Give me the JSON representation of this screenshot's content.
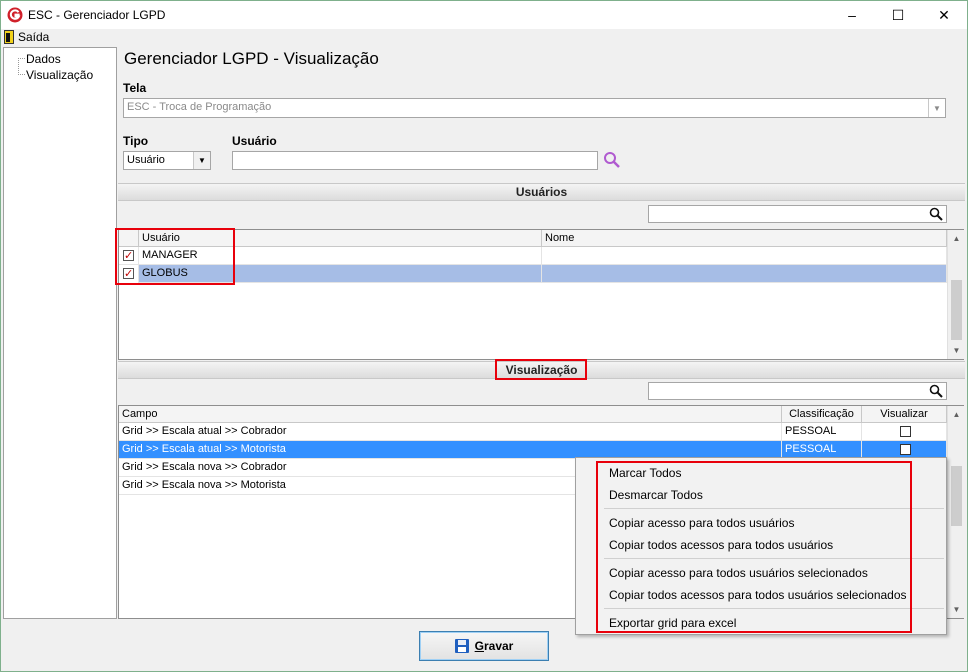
{
  "window": {
    "title": "ESC - Gerenciador LGPD",
    "minimize": "–",
    "maximize": "☐",
    "close": "✕"
  },
  "menu": {
    "saida": "Saída"
  },
  "tree": {
    "items": [
      "Dados",
      "Visualização"
    ]
  },
  "main": {
    "title": "Gerenciador LGPD - Visualização",
    "tela_label": "Tela",
    "tela_value": "ESC - Troca de Programação",
    "tipo_label": "Tipo",
    "tipo_value": "Usuário",
    "usuario_label": "Usuário",
    "usuario_value": ""
  },
  "usuarios_section": {
    "header": "Usuários",
    "search_value": "",
    "columns": [
      "Usuário",
      "Nome"
    ],
    "rows": [
      {
        "checked": true,
        "usuario": "MANAGER",
        "nome": ""
      },
      {
        "checked": true,
        "usuario": "GLOBUS",
        "nome": ""
      }
    ]
  },
  "visualizacao_section": {
    "header": "Visualização",
    "search_value": "",
    "columns": [
      "Campo",
      "Classificação",
      "Visualizar"
    ],
    "rows": [
      {
        "campo": "Grid >> Escala atual >> Cobrador",
        "classificacao": "PESSOAL",
        "visualizar": false
      },
      {
        "campo": "Grid >> Escala atual >> Motorista",
        "classificacao": "PESSOAL",
        "visualizar": false
      },
      {
        "campo": "Grid >> Escala nova >> Cobrador",
        "classificacao": "",
        "visualizar": false
      },
      {
        "campo": "Grid >> Escala nova >> Motorista",
        "classificacao": "",
        "visualizar": false
      }
    ]
  },
  "context_menu": {
    "items": [
      "Marcar Todos",
      "Desmarcar Todos",
      "Copiar acesso para todos usuários",
      "Copiar todos acessos para todos usuários",
      "Copiar acesso para todos usuários selecionados",
      "Copiar todos acessos para todos usuários selecionados",
      "Exportar grid para excel"
    ]
  },
  "buttons": {
    "gravar": "Gravar"
  },
  "colors": {
    "highlight": "#e8000b",
    "selection": "#3390ff",
    "selection_pale": "#a6bde6",
    "logo": "#d0202a"
  },
  "icons": [
    "app-logo-icon",
    "door-icon",
    "search-icon",
    "floppy-icon"
  ]
}
